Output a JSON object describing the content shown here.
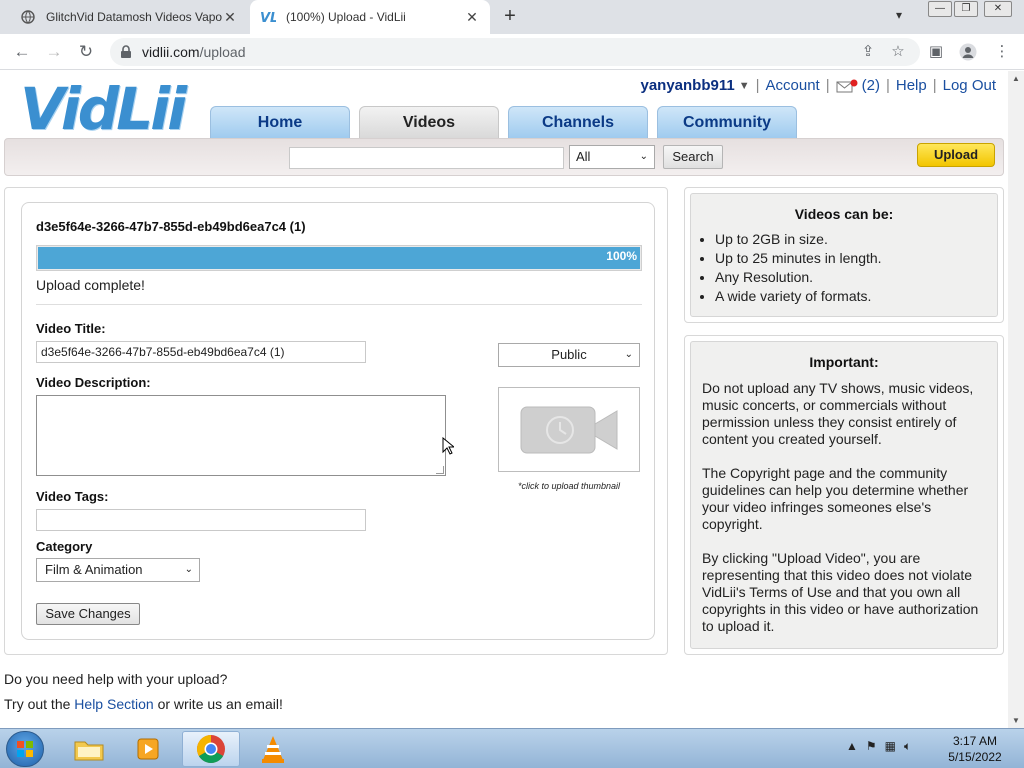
{
  "browser": {
    "tabs": [
      {
        "title": "GlitchVid Datamosh Videos Vapo",
        "active": false
      },
      {
        "title": "(100%) Upload - VidLii",
        "active": true
      }
    ],
    "url_host": "vidlii.com",
    "url_path": "/upload"
  },
  "site": {
    "logo": "VidLii",
    "username": "yanyanbb911",
    "account_link": "Account",
    "messages_count": "(2)",
    "help_link": "Help",
    "logout_link": "Log Out",
    "nav_tabs": [
      {
        "label": "Home",
        "active": false
      },
      {
        "label": "Videos",
        "active": true
      },
      {
        "label": "Channels",
        "active": false
      },
      {
        "label": "Community",
        "active": false
      }
    ],
    "search": {
      "value": "",
      "category": "All",
      "button": "Search"
    },
    "upload_button": "Upload"
  },
  "upload": {
    "filename": "d3e5f64e-3266-47b7-855d-eb49bd6ea7c4 (1)",
    "progress": 100,
    "progress_label": "100%",
    "status": "Upload complete!",
    "title_label": "Video Title:",
    "title_value": "d3e5f64e-3266-47b7-855d-eb49bd6ea7c4 (1)",
    "description_label": "Video Description:",
    "description_value": "",
    "tags_label": "Video Tags:",
    "tags_value": "",
    "category_label": "Category",
    "category_value": "Film & Animation",
    "privacy_value": "Public",
    "thumbnail_caption": "*click to upload thumbnail",
    "save_button": "Save Changes"
  },
  "sidebar": {
    "videos_can_be": {
      "title": "Videos can be:",
      "items": [
        "Up to 2GB in size.",
        "Up to 25 minutes in length.",
        "Any Resolution.",
        "A wide variety of formats."
      ]
    },
    "important": {
      "title": "Important:",
      "p1": "Do not upload any TV shows, music videos, music concerts, or commercials without permission unless they consist entirely of content you created yourself.",
      "p2": "The Copyright page and the community guidelines can help you determine whether your video infringes someones else's copyright.",
      "p3": "By clicking \"Upload Video\", you are representing that this video does not violate VidLii's Terms of Use and that you own all copyrights in this video or have authorization to upload it."
    }
  },
  "footer": {
    "help_q": "Do you need help with your upload?",
    "try_prefix": "Try out the ",
    "help_section_link": "Help Section",
    "try_suffix": " or write us an email!"
  },
  "taskbar": {
    "time": "3:17 AM",
    "date": "5/15/2022",
    "apps": [
      "windows-explorer",
      "media-player",
      "chrome",
      "vlc"
    ]
  },
  "colors": {
    "brand_blue": "#3b8fd0",
    "nav_tab": "#9fcbef",
    "progress_fill": "#4da6d6",
    "upload_yellow": "#f2c500",
    "link": "#1a4fa0"
  }
}
